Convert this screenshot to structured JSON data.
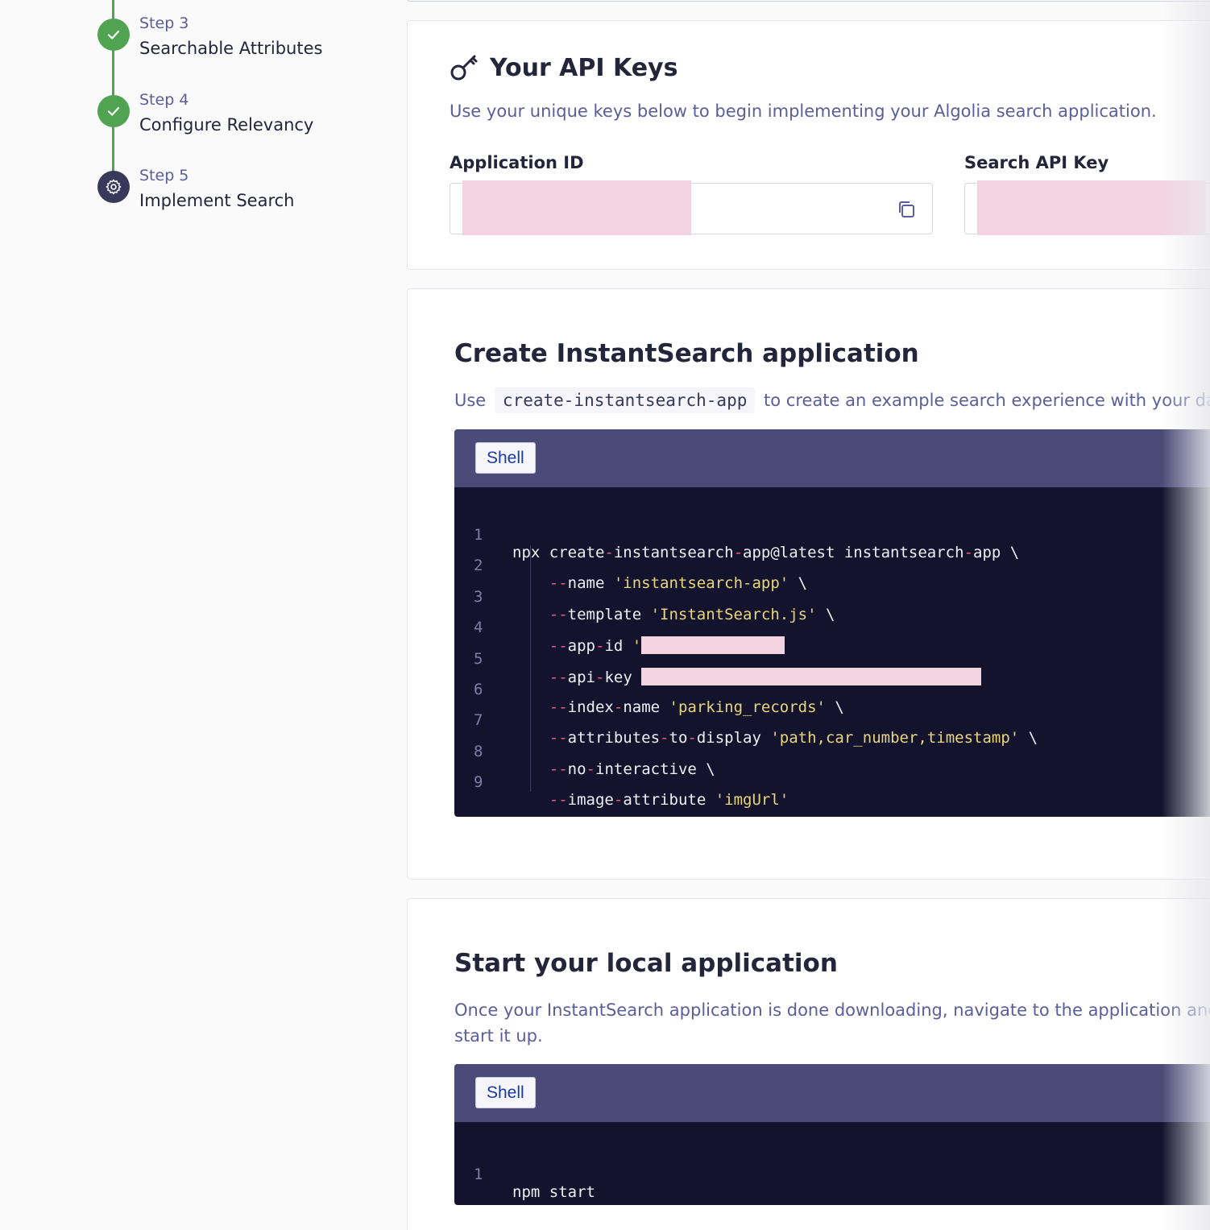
{
  "stepper": {
    "steps": [
      {
        "num": "Step 3",
        "title": "Searchable Attributes",
        "state": "done"
      },
      {
        "num": "Step 4",
        "title": "Configure Relevancy",
        "state": "done"
      },
      {
        "num": "Step 5",
        "title": "Implement Search",
        "state": "current"
      }
    ]
  },
  "api_keys": {
    "title": "Your API Keys",
    "subtitle": "Use your unique keys below to begin implementing your Algolia search application.",
    "app_id_label": "Application ID",
    "search_key_label": "Search API Key"
  },
  "create_section": {
    "title": "Create InstantSearch application",
    "desc_prefix": "Use",
    "desc_code": "create-instantsearch-app",
    "desc_suffix": "to create an example search experience with your da",
    "tab_label": "Shell",
    "line_numbers": [
      "1",
      "2",
      "3",
      "4",
      "5",
      "6",
      "7",
      "8",
      "9"
    ]
  },
  "start_section": {
    "title": "Start your local application",
    "desc_line1": "Once your InstantSearch application is done downloading, navigate to the application and r",
    "desc_line2": "start it up.",
    "tab_label": "Shell",
    "line_numbers": [
      "1"
    ],
    "code": "npm start"
  },
  "colors": {
    "done": "#4fa351",
    "current": "#36395a",
    "code_bg": "#14132e",
    "code_header": "#4a4b78",
    "flag": "#e85a80",
    "string": "#e9d678"
  }
}
